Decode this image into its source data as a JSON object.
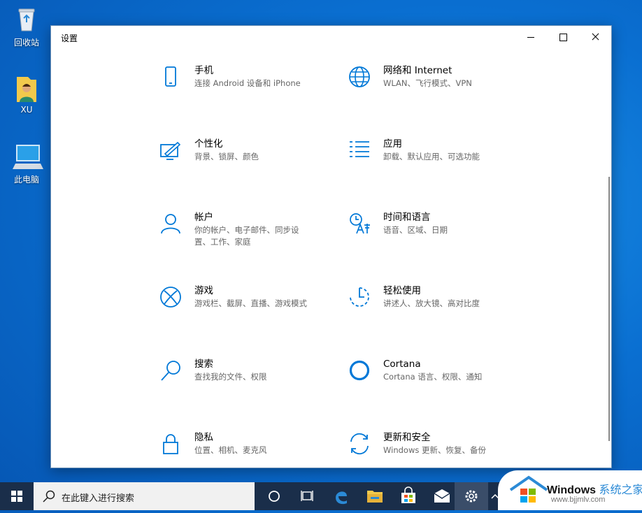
{
  "desktop": {
    "icons": [
      {
        "label": "回收站"
      },
      {
        "label": "XU"
      },
      {
        "label": "此电脑"
      }
    ]
  },
  "window": {
    "title": "设置",
    "items": [
      {
        "name": "手机",
        "desc": "连接 Android 设备和 iPhone",
        "icon": "phone-icon"
      },
      {
        "name": "网络和 Internet",
        "desc": "WLAN、飞行模式、VPN",
        "icon": "globe-icon"
      },
      {
        "name": "个性化",
        "desc": "背景、锁屏、颜色",
        "icon": "personalization-icon"
      },
      {
        "name": "应用",
        "desc": "卸载、默认应用、可选功能",
        "icon": "apps-list-icon"
      },
      {
        "name": "帐户",
        "desc": "你的帐户、电子邮件、同步设置、工作、家庭",
        "icon": "person-icon"
      },
      {
        "name": "时间和语言",
        "desc": "语音、区域、日期",
        "icon": "time-language-icon"
      },
      {
        "name": "游戏",
        "desc": "游戏栏、截屏、直播、游戏模式",
        "icon": "xbox-icon"
      },
      {
        "name": "轻松使用",
        "desc": "讲述人、放大镜、高对比度",
        "icon": "ease-of-access-icon"
      },
      {
        "name": "搜索",
        "desc": "查找我的文件、权限",
        "icon": "search-icon"
      },
      {
        "name": "Cortana",
        "desc": "Cortana 语言、权限、通知",
        "icon": "cortana-icon"
      },
      {
        "name": "隐私",
        "desc": "位置、相机、麦克风",
        "icon": "lock-icon"
      },
      {
        "name": "更新和安全",
        "desc": "Windows 更新、恢复、备份",
        "icon": "update-icon"
      }
    ]
  },
  "taskbar": {
    "search_placeholder": "在此键入进行搜索"
  },
  "watermark": {
    "brand": "Windows",
    "brand_suffix": "系统之家",
    "url": "www.bjjmlv.com"
  },
  "colors": {
    "accent": "#0078d7",
    "desktop": "#0a6fd1",
    "taskbar": "#1a2e4a"
  }
}
